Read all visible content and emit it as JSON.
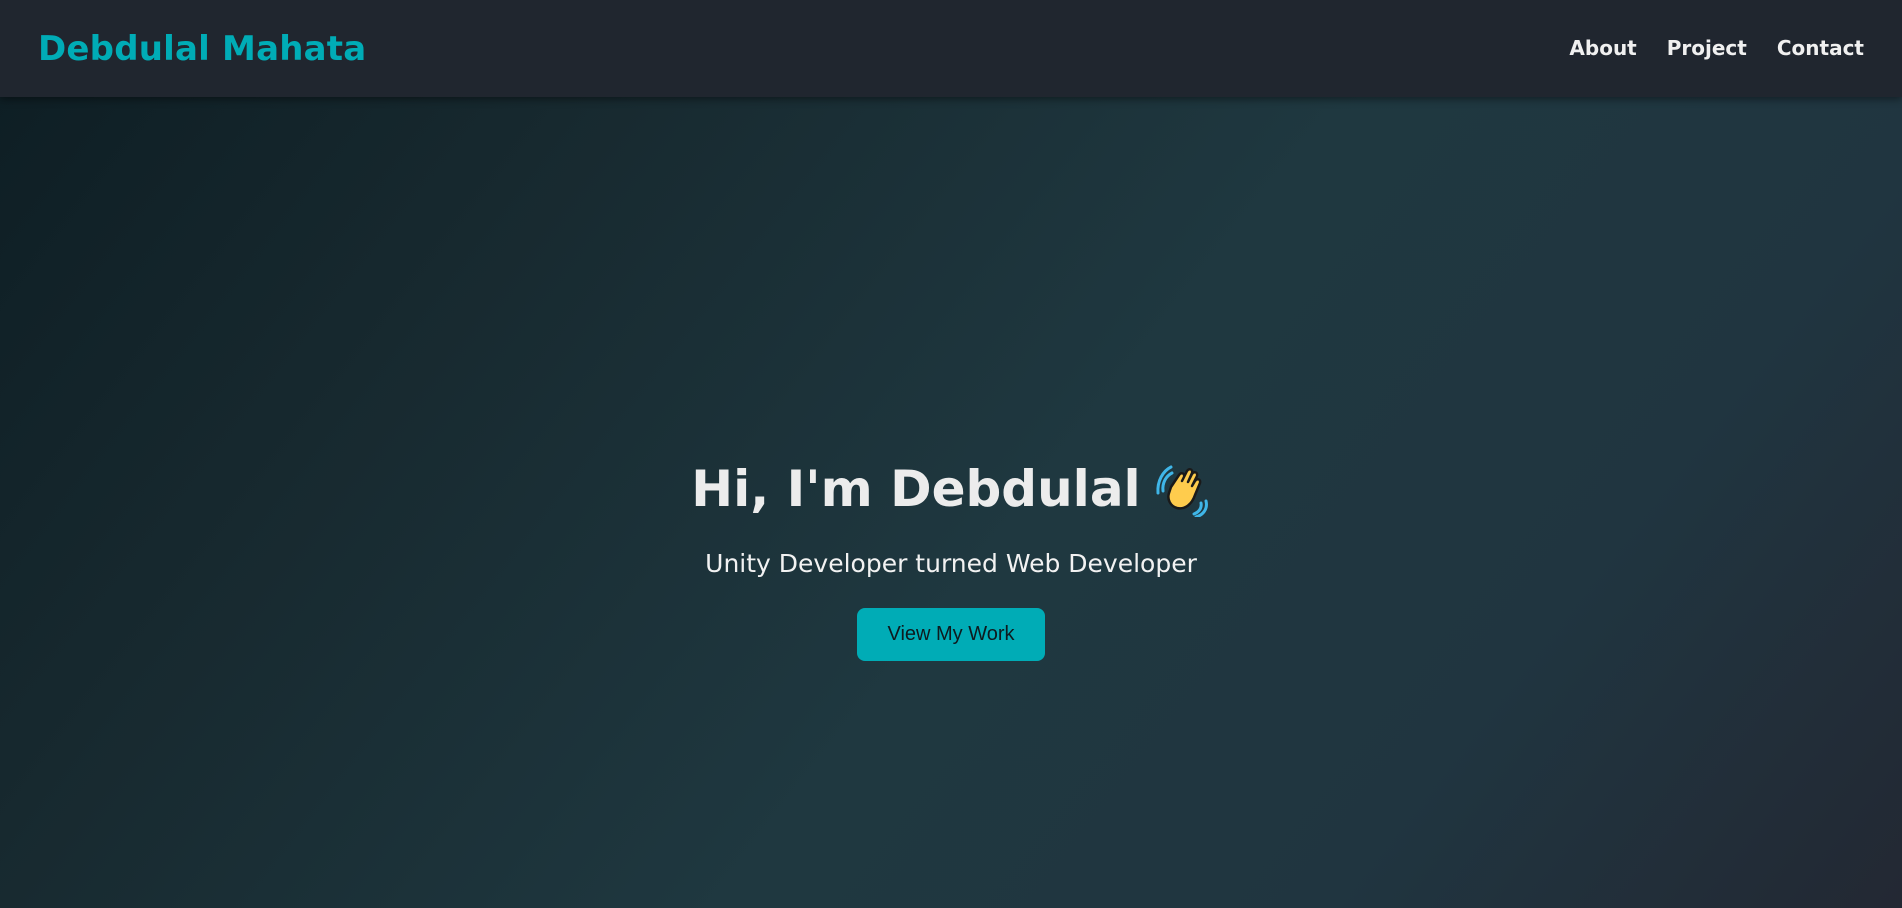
{
  "theme": {
    "accent": "#00acb6",
    "navbar_bg": "#20262f",
    "text": "#ececec"
  },
  "header": {
    "brand": "Debdulal Mahata",
    "nav": [
      {
        "label": "About"
      },
      {
        "label": "Project"
      },
      {
        "label": "Contact"
      }
    ]
  },
  "hero": {
    "heading": "Hi, I'm Debdulal",
    "heading_icon": "waving-hand-icon",
    "subtitle": "Unity Developer turned Web Developer",
    "cta_label": "View My Work"
  }
}
